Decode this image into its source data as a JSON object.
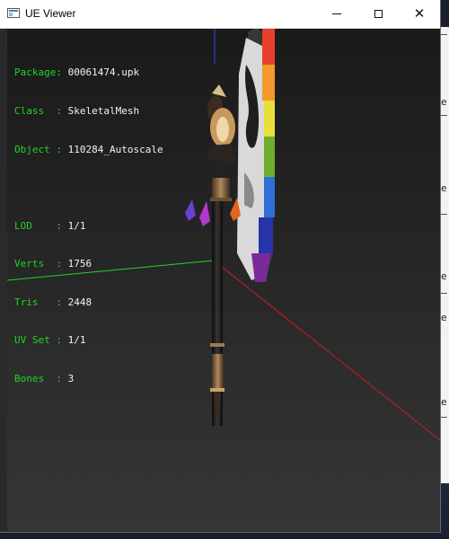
{
  "window": {
    "title": "UE Viewer"
  },
  "info_panel": {
    "package_label": "Package:",
    "package_value": "00061474.upk",
    "class_label": "Class  :",
    "class_value": "SkeletalMesh",
    "object_label": "Object :",
    "object_value": "110284_Autoscale",
    "lod_label": "LOD    :",
    "lod_value": "1/1",
    "verts_label": "Verts  :",
    "verts_value": "1756",
    "tris_label": "Tris   :",
    "tris_value": "2448",
    "uvset_label": "UV Set :",
    "uvset_value": "1/1",
    "bones_label": "Bones  :",
    "bones_value": "3"
  },
  "axis_colors": {
    "x_axis": "#d21b1b",
    "y_axis": "#2ad12a",
    "z_axis": "#2d3ad8"
  },
  "icons": {
    "app": "ue-viewer-window-icon",
    "minimize": "minimize-icon",
    "maximize": "maximize-icon",
    "close": "close-icon"
  },
  "background_window_fragments": {
    "bracket": "[",
    "letter": "e"
  }
}
